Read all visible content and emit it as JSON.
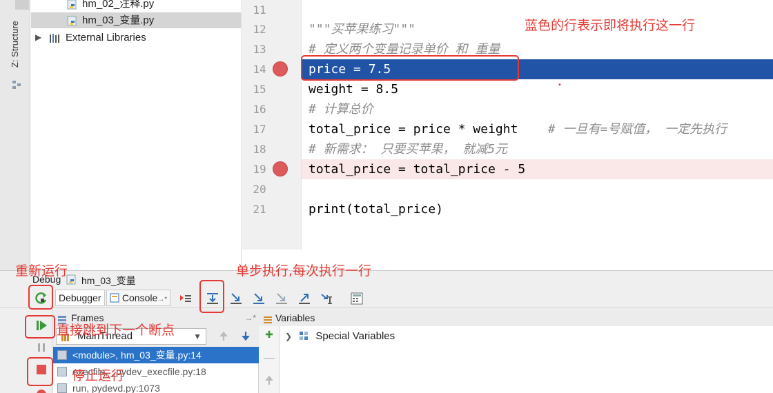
{
  "sidebar": {
    "structure_tab_label": "Z: Structure"
  },
  "project_tree": {
    "items": [
      {
        "label": "hm_02_注释.py",
        "icon": "python-file-icon"
      },
      {
        "label": "hm_03_变量.py",
        "icon": "python-file-icon",
        "selected": true
      },
      {
        "label": "External Libraries",
        "icon": "library-icon",
        "expandable": true
      }
    ]
  },
  "editor": {
    "lines": [
      {
        "no": "11",
        "code": ""
      },
      {
        "no": "12",
        "code": "\"\"\"买苹果练习\"\"\""
      },
      {
        "no": "13",
        "code": "# 定义两个变量记录单价 和 重量"
      },
      {
        "no": "14",
        "code": "price = 7.5",
        "breakpoint": true,
        "current": true
      },
      {
        "no": "15",
        "code": "weight = 8.5"
      },
      {
        "no": "16",
        "code": "# 计算总价"
      },
      {
        "no": "17",
        "code": "total_price = price * weight",
        "comment": "# 一旦有=号赋值， 一定先执行"
      },
      {
        "no": "18",
        "code": "# 新需求： 只要买苹果， 就减5元"
      },
      {
        "no": "19",
        "code": "total_price = total_price - 5",
        "breakpoint": true
      },
      {
        "no": "20",
        "code": ""
      },
      {
        "no": "21",
        "code": "print(total_price)"
      }
    ]
  },
  "annotations": {
    "current_line_note": "蓝色的行表示即将执行这一行",
    "rerun_note": "重新运行",
    "step_over_note": "单步执行,每次执行一行",
    "resume_note": "直接跳到下一个断点",
    "stop_note": "停止运行"
  },
  "debug": {
    "title": "Debug",
    "config_name": "hm_03_变量",
    "tabs": [
      {
        "label": "Debugger",
        "active": true
      },
      {
        "label": "Console",
        "suffix": "→*"
      }
    ],
    "frames_title": "Frames",
    "thread_name": "MainThread",
    "frames": [
      {
        "label": "<module>, hm_03_变量.py:14",
        "selected": true
      },
      {
        "label": "execfile, _pydev_execfile.py:18"
      },
      {
        "label": "run, pydevd.py:1073"
      }
    ],
    "variables_title": "Variables",
    "variables": [
      {
        "label": "Special Variables"
      }
    ]
  },
  "colors": {
    "current_line": "#2154a6",
    "breakpoint": "#dc5a5a",
    "annotation": "#e53935",
    "selected_frame": "#2a73c9"
  }
}
